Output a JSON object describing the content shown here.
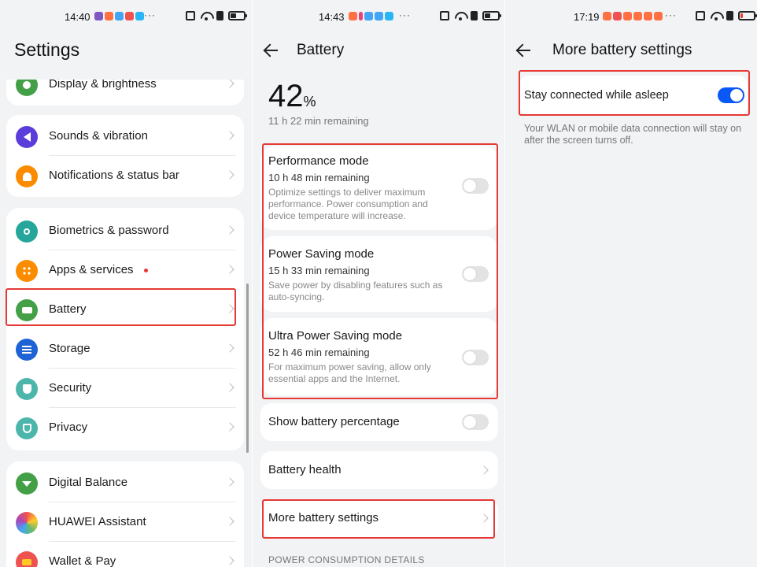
{
  "panel1": {
    "status": {
      "time": "14:40",
      "app_colors": [
        "#7e57c2",
        "#ff7043",
        "#42a5f5",
        "#ef5350",
        "#29b6f6"
      ],
      "more": "···"
    },
    "title": "Settings",
    "items_group0": [
      {
        "label": "Display & brightness",
        "icon": "display-icon",
        "color": "#43a047"
      }
    ],
    "items_group1": [
      {
        "label": "Sounds & vibration",
        "icon": "sound-icon",
        "color": "#5c3ddb"
      },
      {
        "label": "Notifications & status bar",
        "icon": "bell-icon",
        "color": "#fb8c00"
      }
    ],
    "items_group2": [
      {
        "label": "Biometrics & password",
        "icon": "key-icon",
        "color": "#26a69a"
      },
      {
        "label": "Apps & services",
        "icon": "apps-grid-icon",
        "color": "#fb8c00",
        "badge": true
      },
      {
        "label": "Battery",
        "icon": "battery-icon",
        "color": "#43a047"
      },
      {
        "label": "Storage",
        "icon": "storage-icon",
        "color": "#1e63d6"
      },
      {
        "label": "Security",
        "icon": "shield-icon",
        "color": "#4db6ac"
      },
      {
        "label": "Privacy",
        "icon": "privacy-icon",
        "color": "#4db6ac"
      }
    ],
    "items_group3": [
      {
        "label": "Digital Balance",
        "icon": "hourglass-icon",
        "color": "#43a047"
      },
      {
        "label": "HUAWEI Assistant",
        "icon": "assistant-icon",
        "color": "#ab47bc"
      },
      {
        "label": "Wallet & Pay",
        "icon": "wallet-icon",
        "color": "#ef5350"
      }
    ]
  },
  "panel2": {
    "status": {
      "time": "14:43",
      "app_colors": [
        "#ff7043",
        "#ec407a",
        "#42a5f5",
        "#42a5f5",
        "#29b6f6"
      ],
      "more": "···"
    },
    "title": "Battery",
    "percent": "42",
    "percent_unit": "%",
    "remaining": "11 h 22 min remaining",
    "modes": [
      {
        "title": "Performance mode",
        "sub": "10 h 48 min remaining",
        "desc": "Optimize settings to deliver maximum performance. Power consumption and device temperature will increase.",
        "on": false
      },
      {
        "title": "Power Saving mode",
        "sub": "15 h 33 min remaining",
        "desc": "Save power by disabling features such as auto-syncing.",
        "on": false
      },
      {
        "title": "Ultra Power Saving mode",
        "sub": "52 h 46 min remaining",
        "desc": "For maximum power saving, allow only essential apps and the Internet.",
        "on": false
      }
    ],
    "show_percentage": "Show battery percentage",
    "battery_health": "Battery health",
    "more_settings": "More battery settings",
    "section": "POWER CONSUMPTION DETAILS"
  },
  "panel3": {
    "status": {
      "time": "17:19",
      "app_colors": [
        "#ff7043",
        "#ef5350",
        "#ff7043",
        "#ff7043",
        "#ff7043",
        "#ff7043"
      ],
      "more": "···"
    },
    "title": "More battery settings",
    "stay_connected": "Stay connected while asleep",
    "stay_connected_on": true,
    "note": "Your WLAN or mobile data connection will stay on after the screen turns off."
  },
  "colors": {
    "highlight": "#e53935",
    "accent": "#0a59f7",
    "background": "#f1f3f5"
  }
}
